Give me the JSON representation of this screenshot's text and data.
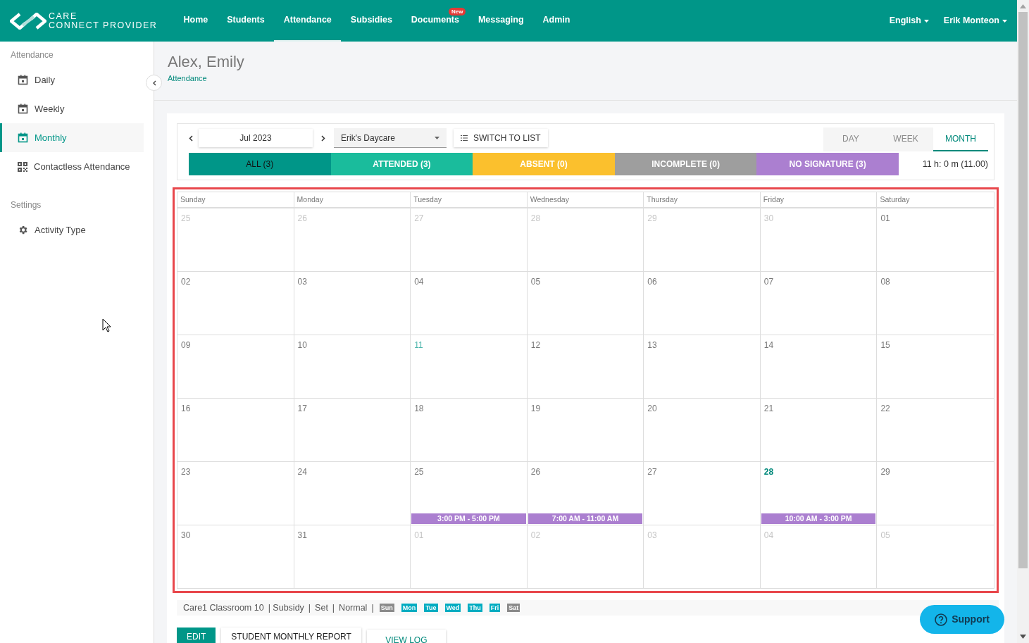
{
  "brand": {
    "line1": "CARE",
    "line2": "CONNECT PROVIDER"
  },
  "nav": [
    {
      "label": "Home",
      "selected": false
    },
    {
      "label": "Students",
      "selected": false
    },
    {
      "label": "Attendance",
      "selected": true
    },
    {
      "label": "Subsidies",
      "selected": false
    },
    {
      "label": "Documents",
      "selected": false,
      "badge": "New"
    },
    {
      "label": "Messaging",
      "selected": false
    },
    {
      "label": "Admin",
      "selected": false
    }
  ],
  "header_menus": [
    "English",
    "Erik Monteon"
  ],
  "sidebar": {
    "sections": [
      {
        "title": "Attendance",
        "items": [
          {
            "label": "Daily",
            "kind": "calendar",
            "selected": false
          },
          {
            "label": "Weekly",
            "kind": "calendar",
            "selected": false
          },
          {
            "label": "Monthly",
            "kind": "calendar",
            "selected": true
          },
          {
            "label": "Contactless Attendance",
            "kind": "qr",
            "selected": false
          }
        ]
      },
      {
        "title": "Settings",
        "items": [
          {
            "label": "Activity Type",
            "kind": "gear",
            "selected": false
          }
        ]
      }
    ]
  },
  "page": {
    "title": "Alex, Emily",
    "breadcrumb": "Attendance"
  },
  "toolbar": {
    "month": "Jul 2023",
    "location": "Erik's Daycare",
    "switch_label": "SWITCH TO LIST",
    "views": [
      {
        "label": "DAY",
        "selected": false
      },
      {
        "label": "WEEK",
        "selected": false
      },
      {
        "label": "MONTH",
        "selected": true
      }
    ]
  },
  "filters": [
    {
      "label": "ALL (3)",
      "color": "#009688",
      "selected": true
    },
    {
      "label": "ATTENDED (3)",
      "color": "#1abc9c",
      "selected": false
    },
    {
      "label": "ABSENT (0)",
      "color": "#fbc02d",
      "selected": false
    },
    {
      "label": "INCOMPLETE (0)",
      "color": "#9e9e9e",
      "selected": false
    },
    {
      "label": "NO SIGNATURE (3)",
      "color": "#ab7fd0",
      "selected": false
    }
  ],
  "total": "11 h: 0 m (11.00)",
  "calendar": {
    "weekdays": [
      "Sunday",
      "Monday",
      "Tuesday",
      "Wednesday",
      "Thursday",
      "Friday",
      "Saturday"
    ],
    "weeks": [
      [
        {
          "day": "25",
          "kind": "outside"
        },
        {
          "day": "26",
          "kind": "outside"
        },
        {
          "day": "27",
          "kind": "outside"
        },
        {
          "day": "28",
          "kind": "outside"
        },
        {
          "day": "29",
          "kind": "outside"
        },
        {
          "day": "30",
          "kind": "outside"
        },
        {
          "day": "01",
          "kind": "inside"
        }
      ],
      [
        {
          "day": "02",
          "kind": "inside"
        },
        {
          "day": "03",
          "kind": "inside"
        },
        {
          "day": "04",
          "kind": "inside"
        },
        {
          "day": "05",
          "kind": "inside"
        },
        {
          "day": "06",
          "kind": "inside"
        },
        {
          "day": "07",
          "kind": "inside"
        },
        {
          "day": "08",
          "kind": "inside"
        }
      ],
      [
        {
          "day": "09",
          "kind": "inside"
        },
        {
          "day": "10",
          "kind": "inside"
        },
        {
          "day": "11",
          "kind": "marked"
        },
        {
          "day": "12",
          "kind": "inside"
        },
        {
          "day": "13",
          "kind": "inside"
        },
        {
          "day": "14",
          "kind": "inside"
        },
        {
          "day": "15",
          "kind": "inside"
        }
      ],
      [
        {
          "day": "16",
          "kind": "inside"
        },
        {
          "day": "17",
          "kind": "inside"
        },
        {
          "day": "18",
          "kind": "inside"
        },
        {
          "day": "19",
          "kind": "inside"
        },
        {
          "day": "20",
          "kind": "inside"
        },
        {
          "day": "21",
          "kind": "inside"
        },
        {
          "day": "22",
          "kind": "inside"
        }
      ],
      [
        {
          "day": "23",
          "kind": "inside"
        },
        {
          "day": "24",
          "kind": "inside"
        },
        {
          "day": "25",
          "kind": "inside",
          "event": "3:00 PM - 5:00 PM"
        },
        {
          "day": "26",
          "kind": "inside",
          "event": "7:00 AM - 11:00 AM"
        },
        {
          "day": "27",
          "kind": "inside"
        },
        {
          "day": "28",
          "kind": "today",
          "event": "10:00 AM - 3:00 PM"
        },
        {
          "day": "29",
          "kind": "inside"
        }
      ],
      [
        {
          "day": "30",
          "kind": "inside"
        },
        {
          "day": "31",
          "kind": "inside"
        },
        {
          "day": "01",
          "kind": "outside"
        },
        {
          "day": "02",
          "kind": "outside"
        },
        {
          "day": "03",
          "kind": "outside"
        },
        {
          "day": "04",
          "kind": "outside"
        },
        {
          "day": "05",
          "kind": "outside"
        }
      ]
    ]
  },
  "info": {
    "parts": [
      "Care1 Classroom 10",
      "| Subsidy",
      "|",
      "Set",
      "|",
      "Normal",
      "|"
    ],
    "days": [
      {
        "label": "Sun",
        "on": false
      },
      {
        "label": "Mon",
        "on": true
      },
      {
        "label": "Tue",
        "on": true
      },
      {
        "label": "Wed",
        "on": true
      },
      {
        "label": "Thu",
        "on": true
      },
      {
        "label": "Fri",
        "on": true
      },
      {
        "label": "Sat",
        "on": false
      }
    ]
  },
  "actions": [
    "EDIT",
    "STUDENT MONTHLY REPORT",
    "VIEW LOG"
  ],
  "support": "Support"
}
